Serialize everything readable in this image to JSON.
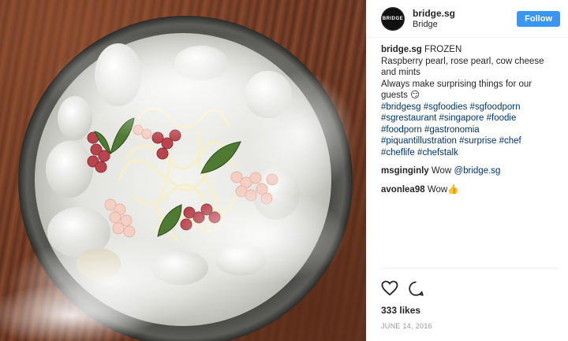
{
  "header": {
    "avatar_text": "BRIDGE",
    "username": "bridge.sg",
    "location": "Bridge",
    "follow_label": "Follow"
  },
  "caption": {
    "username": "bridge.sg",
    "lines": [
      "FROZEN",
      "Raspberry pearl, rose pearl, cow cheese and mints",
      "Always make surprising things for our guests 😏"
    ],
    "hashtags": [
      "#bridgesg",
      "#sgfoodies",
      "#sgfoodporn",
      "#sgrestaurant",
      "#singapore",
      "#foodie",
      "#foodporn",
      "#gastronomia",
      "#piquantillustration",
      "#surprise",
      "#chef",
      "#cheflife",
      "#chefstalk"
    ]
  },
  "comments": [
    {
      "username": "msginginly",
      "text": "Wow ",
      "mention": "@bridge.sg"
    },
    {
      "username": "avonlea98",
      "text": "Wow👍",
      "mention": ""
    }
  ],
  "actions": {
    "like_icon": "heart-outline-icon",
    "comment_icon": "comment-bubble-icon",
    "likes_text": "333 likes",
    "date": "JUNE 14, 2016"
  },
  "colors": {
    "follow_blue": "#3897f0",
    "hashtag_blue": "#003569",
    "divider": "#efefef"
  }
}
